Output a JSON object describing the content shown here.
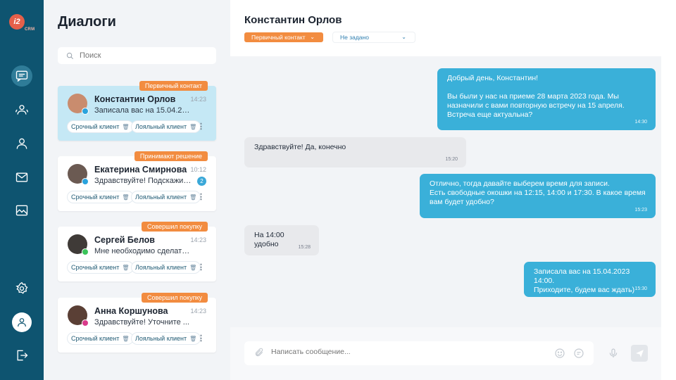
{
  "app": {
    "logo_text": "i2",
    "logo_sub": "CRM"
  },
  "rail": {
    "items": [
      "chat-icon",
      "contacts-icon",
      "user-icon",
      "mail-icon",
      "gallery-icon",
      "settings-icon",
      "avatar-icon",
      "logout-icon"
    ],
    "active": "chat-icon"
  },
  "list": {
    "title": "Диалоги",
    "search_placeholder": "Поиск",
    "cards": [
      {
        "name": "Константин Орлов",
        "time": "14:23",
        "preview": "Записала вас на 15.04.2023...",
        "tag": "Первичный контакт",
        "chips": [
          "Срочный клиент",
          "Лояльный клиент"
        ],
        "network": "telegram",
        "unread": "",
        "selected": true
      },
      {
        "name": "Екатерина Смирнова",
        "time": "10:12",
        "preview": "Здравствуйте! Подскажите ...",
        "tag": "Принимают решение",
        "chips": [
          "Срочный клиент",
          "Лояльный клиент"
        ],
        "network": "telegram",
        "unread": "2",
        "selected": false
      },
      {
        "name": "Сергей Белов",
        "time": "14:23",
        "preview": "Мне необходимо сделать в ...",
        "tag": "Совершил покупку",
        "chips": [
          "Срочный клиент",
          "Лояльный клиент"
        ],
        "network": "whatsapp",
        "unread": "",
        "selected": false
      },
      {
        "name": "Анна Коршунова",
        "time": "14:23",
        "preview": "Здравствуйте! Уточните ...",
        "tag": "Совершил покупку",
        "chips": [
          "Срочный клиент",
          "Лояльный клиент"
        ],
        "network": "instagram",
        "unread": "",
        "selected": false
      }
    ]
  },
  "chat": {
    "name": "Константин Орлов",
    "status_select": "Первичный контакт",
    "second_select": "Не задано",
    "messages": [
      {
        "dir": "out",
        "lines": [
          "Добрый день, Константин!",
          "",
          "Вы были у нас на приеме 28 марта 2023 года. Мы назначили с вами повторную встречу на 15 апреля. Встреча еще актуальна?"
        ],
        "time": "14:30"
      },
      {
        "dir": "in",
        "lines": [
          "Здравствуйте! Да, конечно"
        ],
        "time": "15:20"
      },
      {
        "dir": "out",
        "lines": [
          "Отлично, тогда давайте выберем время для записи.",
          "Есть свободные окошки на 12:15, 14:00 и 17:30. В какое время вам будет удобно?"
        ],
        "time": "15:23"
      },
      {
        "dir": "in",
        "lines": [
          "На 14:00 удобно"
        ],
        "time": "15:28"
      },
      {
        "dir": "out",
        "lines": [
          "Записала вас на 15.04.2023 14:00.",
          "Приходите, будем вас ждать)"
        ],
        "time": "15:30"
      }
    ],
    "composer_placeholder": "Написать сообщение..."
  },
  "colors": {
    "rail": "#0e5470",
    "accent_orange": "#f28c40",
    "bubble_out": "#3ab0d9",
    "selected_card": "#c5e8f5"
  }
}
